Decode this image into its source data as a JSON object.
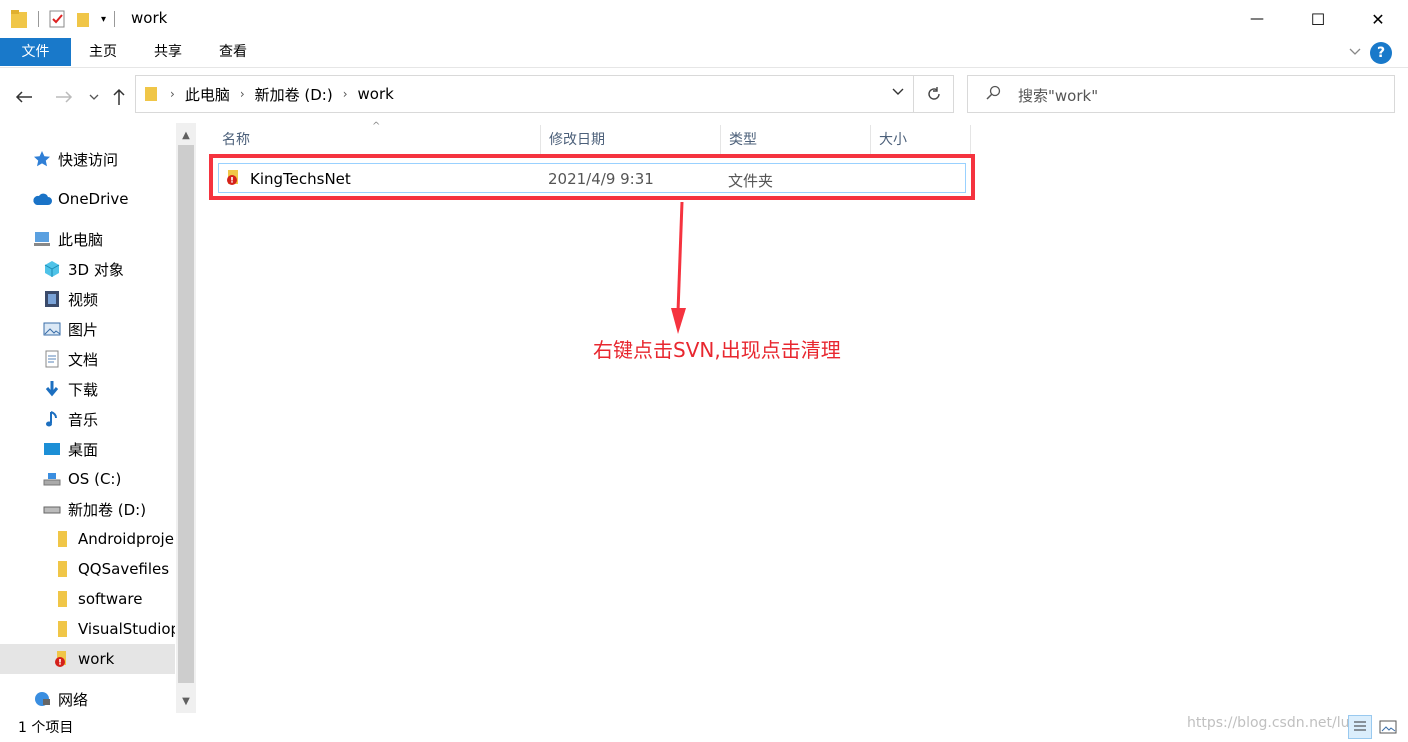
{
  "window": {
    "title": "work",
    "minimize_glyph": "—",
    "maximize_glyph": "☐",
    "close_glyph": "✕"
  },
  "ribbon": {
    "tabs": [
      "文件",
      "主页",
      "共享",
      "查看"
    ],
    "help_glyph": "?"
  },
  "address": {
    "crumbs": [
      "此电脑",
      "新加卷 (D:)",
      "work"
    ],
    "search_placeholder": "搜索\"work\""
  },
  "sidebar": {
    "items": [
      {
        "label": "快速访问",
        "icon": "star-icon"
      },
      {
        "label": "OneDrive",
        "icon": "cloud-icon"
      },
      {
        "label": "此电脑",
        "icon": "computer-icon"
      },
      {
        "label": "3D 对象",
        "icon": "cube-icon"
      },
      {
        "label": "视频",
        "icon": "video-icon"
      },
      {
        "label": "图片",
        "icon": "picture-icon"
      },
      {
        "label": "文档",
        "icon": "document-icon"
      },
      {
        "label": "下载",
        "icon": "download-icon"
      },
      {
        "label": "音乐",
        "icon": "music-icon"
      },
      {
        "label": "桌面",
        "icon": "desktop-icon"
      },
      {
        "label": "OS (C:)",
        "icon": "drive-icon"
      },
      {
        "label": "新加卷 (D:)",
        "icon": "drive-icon"
      },
      {
        "label": "Androidproje",
        "icon": "folder-icon"
      },
      {
        "label": "QQSavefiles",
        "icon": "folder-icon"
      },
      {
        "label": "software",
        "icon": "folder-icon"
      },
      {
        "label": "VisualStudiop",
        "icon": "folder-icon"
      },
      {
        "label": "work",
        "icon": "svn-folder-icon"
      },
      {
        "label": "网络",
        "icon": "network-icon"
      }
    ]
  },
  "columns": {
    "name": "名称",
    "modified": "修改日期",
    "type": "类型",
    "size": "大小"
  },
  "files": [
    {
      "name": "KingTechsNet",
      "modified": "2021/4/9 9:31",
      "type": "文件夹",
      "size": ""
    }
  ],
  "annotation": "右键点击SVN,出现点击清理",
  "status": {
    "count": "1 个项目",
    "watermark": "https://blog.csdn.net/lu..."
  },
  "colors": {
    "accent": "#1979ca",
    "annotation_red": "#e8272f",
    "folder_yellow": "#f0c648"
  }
}
